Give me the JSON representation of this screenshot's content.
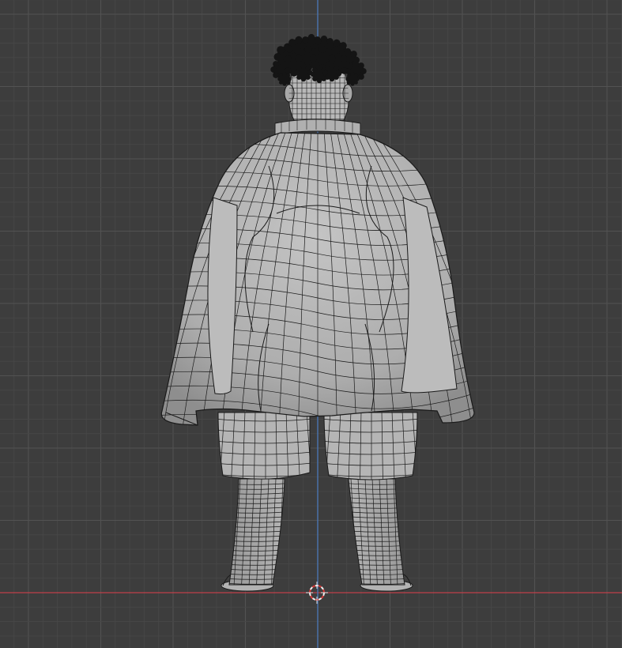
{
  "viewport": {
    "background": "#3d3d3d",
    "grid_minor_color": "#474747",
    "grid_major_color": "#525252",
    "x_axis_color": "#c0404a",
    "z_axis_color": "#4a78b8",
    "mesh_fill_color": "#b8b8b8",
    "mesh_wire_color": "#1a1a1a",
    "hair_color": "#141414",
    "cursor_colors": [
      "#d93a3a",
      "#f0f0f0"
    ]
  },
  "scene": {
    "object": "character-mesh",
    "view": "back-orthographic",
    "overlays": [
      "wireframe",
      "grid-floor",
      "3d-cursor"
    ]
  },
  "icons": {
    "cursor": "3d-cursor-icon"
  }
}
